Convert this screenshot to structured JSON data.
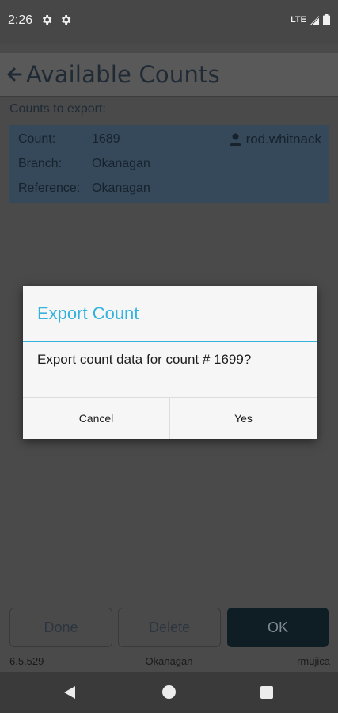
{
  "status": {
    "time": "2:26",
    "network": "LTE",
    "icons": [
      "settings-gear-icon",
      "settings-gear-icon",
      "signal-icon",
      "battery-icon"
    ]
  },
  "app_bar": {
    "title": "Available Counts",
    "back_icon": "arrow-left-icon"
  },
  "export": {
    "section_label": "Counts to export:",
    "count_label": "Count:",
    "count_value": "1689",
    "user_icon": "person-icon",
    "user": "rod.whitnack",
    "branch_label": "Branch:",
    "branch_value": "Okanagan",
    "reference_label": "Reference:",
    "reference_value": "Okanagan"
  },
  "dialog": {
    "title": "Export Count",
    "message": "Export count data for count #  1699?",
    "cancel_label": "Cancel",
    "yes_label": "Yes",
    "accent": "#33b3dd"
  },
  "buttons": {
    "done_label": "Done",
    "delete_label": "Delete",
    "ok_label": "OK"
  },
  "footer": {
    "version": "6.5.529",
    "branch": "Okanagan",
    "user": "rmujica"
  },
  "nav": {
    "back_icon": "nav-back-triangle-icon",
    "home_icon": "nav-home-circle-icon",
    "recent_icon": "nav-recent-square-icon"
  }
}
